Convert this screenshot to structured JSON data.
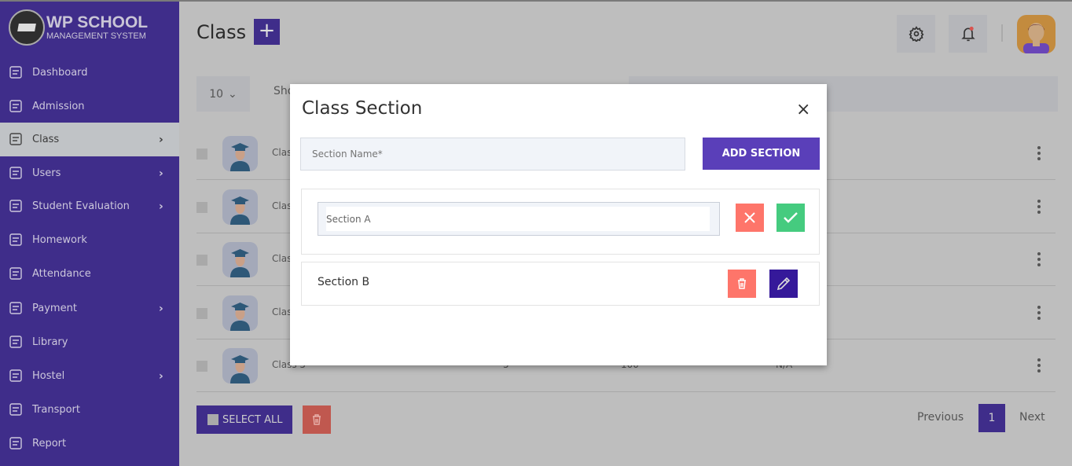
{
  "app": {
    "logo_line1": "WP SCHOOL",
    "logo_line2": "MANAGEMENT SYSTEM"
  },
  "sidebar": {
    "items": [
      {
        "label": "Dashboard",
        "icon": "grid-icon",
        "chevron": false
      },
      {
        "label": "Admission",
        "icon": "form-edit-icon",
        "chevron": false
      },
      {
        "label": "Class",
        "icon": "classroom-icon",
        "chevron": true,
        "active": true
      },
      {
        "label": "Users",
        "icon": "user-icon",
        "chevron": true
      },
      {
        "label": "Student Evaluation",
        "icon": "clipboard-list-icon",
        "chevron": true
      },
      {
        "label": "Homework",
        "icon": "homework-icon",
        "chevron": false
      },
      {
        "label": "Attendance",
        "icon": "clipboard-check-icon",
        "chevron": false
      },
      {
        "label": "Payment",
        "icon": "wallet-icon",
        "chevron": true
      },
      {
        "label": "Library",
        "icon": "books-icon",
        "chevron": false
      },
      {
        "label": "Hostel",
        "icon": "building-icon",
        "chevron": true
      },
      {
        "label": "Transport",
        "icon": "bus-icon",
        "chevron": false
      },
      {
        "label": "Report",
        "icon": "report-icon",
        "chevron": false
      }
    ]
  },
  "header": {
    "title": "Class",
    "add_label": "+"
  },
  "table": {
    "per_page": "10",
    "show_label": "Sho",
    "rows": [
      {
        "name": "Class"
      },
      {
        "name": "Class"
      },
      {
        "name": "Class"
      },
      {
        "name": "Class"
      },
      {
        "name": "Class 5",
        "c2": "5",
        "c3": "100",
        "c4": "N/A"
      }
    ]
  },
  "footer": {
    "select_all": "SELECT ALL",
    "previous": "Previous",
    "page": "1",
    "next": "Next"
  },
  "modal": {
    "title": "Class Section",
    "close": "×",
    "section_placeholder": "Section Name*",
    "add_button": "ADD SECTION",
    "editing_value": "Section A",
    "sections": [
      {
        "name": "Section B"
      }
    ]
  },
  "colors": {
    "sidebar": "#3f2d8a",
    "accent": "#5a3fb9",
    "danger": "#fe756a",
    "success": "#45cb7f",
    "edit": "#35199a"
  }
}
